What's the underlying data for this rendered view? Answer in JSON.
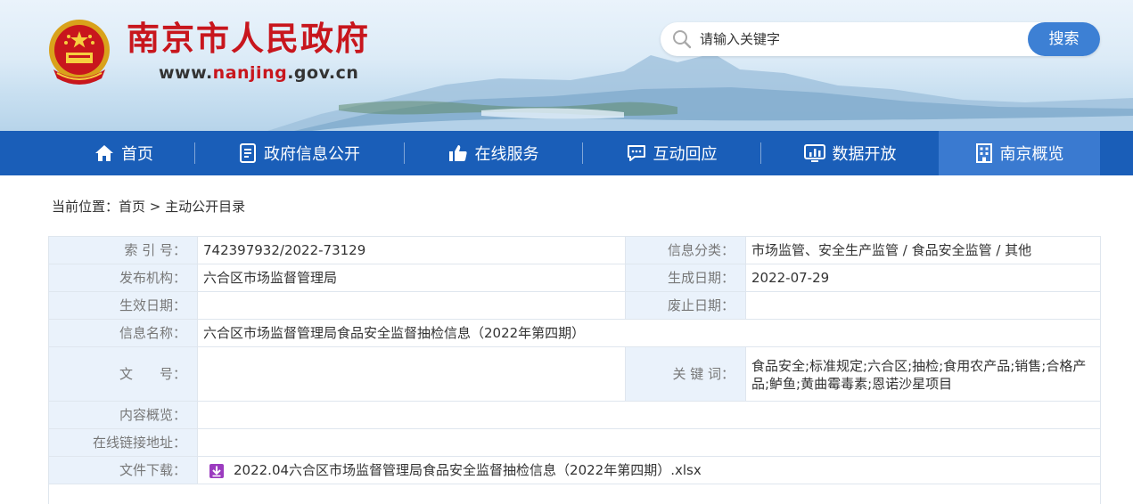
{
  "header": {
    "site_title": "南京市人民政府",
    "url_prefix": "www.",
    "url_highlight": "nanjing",
    "url_suffix": ".gov.cn",
    "search": {
      "placeholder": "请输入关键字",
      "button_label": "搜索"
    }
  },
  "nav": {
    "items": [
      {
        "label": "首页",
        "icon": "home-icon"
      },
      {
        "label": "政府信息公开",
        "icon": "document-icon"
      },
      {
        "label": "在线服务",
        "icon": "thumbs-up-icon"
      },
      {
        "label": "互动回应",
        "icon": "chat-icon"
      },
      {
        "label": "数据开放",
        "icon": "chart-icon"
      },
      {
        "label": "南京概览",
        "icon": "building-icon",
        "active": true
      }
    ]
  },
  "breadcrumb": {
    "prefix": "当前位置：",
    "home": "首页",
    "separator": " > ",
    "current": "主动公开目录"
  },
  "info": {
    "index_label": "索 引 号：",
    "index_value": "742397932/2022-73129",
    "category_label": "信息分类：",
    "category_value": "市场监管、安全生产监管 / 食品安全监管 / 其他",
    "publisher_label": "发布机构：",
    "publisher_value": "六合区市场监督管理局",
    "created_label": "生成日期：",
    "created_value": "2022-07-29",
    "effective_label": "生效日期：",
    "effective_value": "",
    "expiry_label": "废止日期：",
    "expiry_value": "",
    "name_label": "信息名称：",
    "name_value": "六合区市场监督管理局食品安全监督抽检信息（2022年第四期）",
    "docno_label": "文　　号：",
    "docno_value": "",
    "keywords_label": "关 键 词：",
    "keywords_value": "食品安全;标准规定;六合区;抽检;食用农产品;销售;合格产品;鲈鱼;黄曲霉毒素;恩诺沙星项目",
    "summary_label": "内容概览：",
    "summary_value": "",
    "link_label": "在线链接地址：",
    "link_value": "",
    "download_label": "文件下载：",
    "download_file": "2022.04六合区市场监督管理局食品安全监督抽检信息（2022年第四期）.xlsx"
  },
  "colors": {
    "brand_red": "#c8161d",
    "nav_blue": "#1a5eb8",
    "nav_active": "#3a7ad0",
    "search_button": "#3d80d4",
    "label_bg": "#eaf2fb",
    "file_icon": "#9b3bbf"
  }
}
